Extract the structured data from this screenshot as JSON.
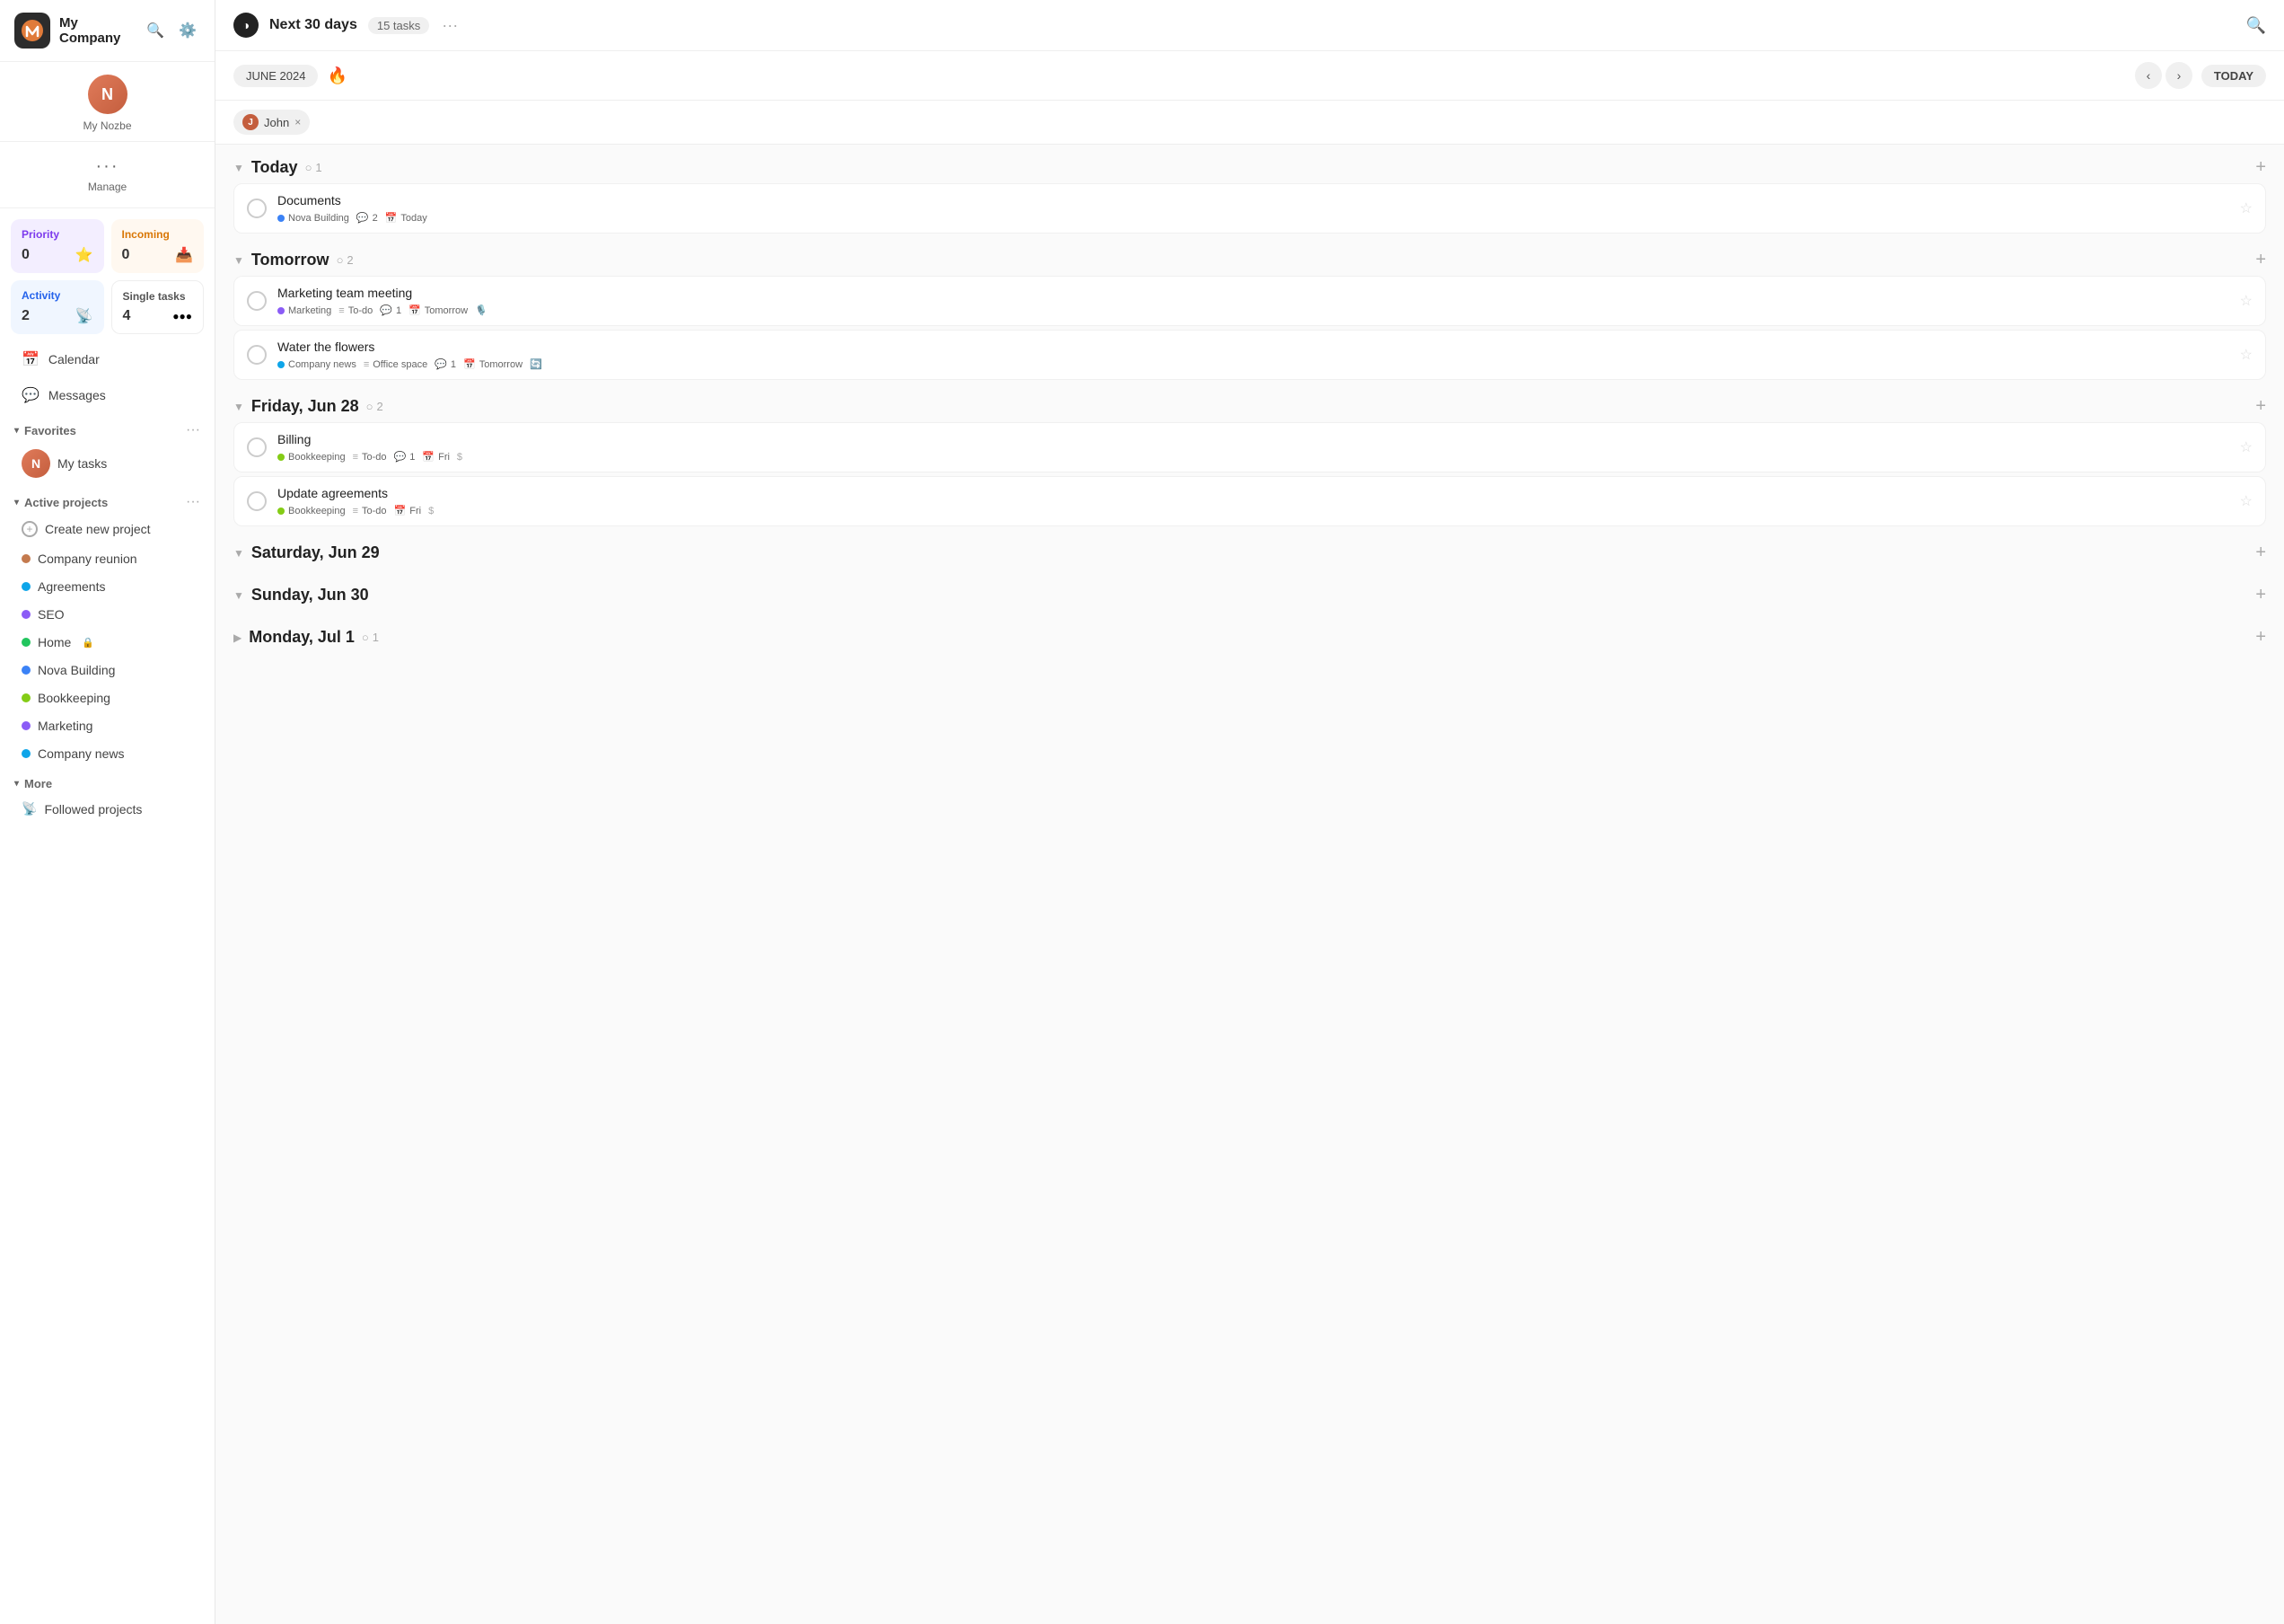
{
  "app": {
    "logo_text": "N",
    "company": "My Company",
    "user_initials": "N",
    "user_name": "My Nozbe"
  },
  "sidebar": {
    "search_label": "Search",
    "settings_label": "Settings",
    "manage_label": "Manage",
    "stats": {
      "priority": {
        "label": "Priority",
        "count": "0",
        "icon": "⭐"
      },
      "incoming": {
        "label": "Incoming",
        "count": "0",
        "icon": "📥"
      },
      "activity": {
        "label": "Activity",
        "count": "2",
        "icon": "📡"
      },
      "single_tasks": {
        "label": "Single tasks",
        "count": "4",
        "icon": "⬤⬤⬤"
      }
    },
    "calendar_label": "Calendar",
    "messages_label": "Messages",
    "favorites_label": "Favorites",
    "my_tasks_label": "My tasks",
    "active_projects_label": "Active projects",
    "projects": [
      {
        "name": "Create new project",
        "color": "none",
        "type": "add"
      },
      {
        "name": "Company reunion",
        "color": "#c47a4e"
      },
      {
        "name": "Agreements",
        "color": "#0ea5e9"
      },
      {
        "name": "SEO",
        "color": "#8b5cf6"
      },
      {
        "name": "Home",
        "color": "#22c55e",
        "locked": true
      },
      {
        "name": "Nova Building",
        "color": "#3b82f6"
      },
      {
        "name": "Bookkeeping",
        "color": "#84cc16"
      },
      {
        "name": "Marketing",
        "color": "#8b5cf6"
      },
      {
        "name": "Company news",
        "color": "#0ea5e9"
      }
    ],
    "more_label": "More",
    "followed_projects_label": "Followed projects"
  },
  "header": {
    "icon": "◑",
    "title": "Next 30 days",
    "task_count": "15 tasks",
    "more_icon": "···"
  },
  "toolbar": {
    "month": "JUNE 2024",
    "today": "TODAY"
  },
  "filter": {
    "user": "John",
    "close": "×"
  },
  "days": [
    {
      "title": "Today",
      "count": 1,
      "tasks": [
        {
          "title": "Documents",
          "project": "Nova Building",
          "project_color": "dot-blue",
          "meta": [
            {
              "icon": "💬",
              "value": "2"
            },
            {
              "icon": "📅",
              "value": "Today"
            }
          ]
        }
      ]
    },
    {
      "title": "Tomorrow",
      "count": 2,
      "tasks": [
        {
          "title": "Marketing team meeting",
          "project": "Marketing",
          "project_color": "dot-purple",
          "meta": [
            {
              "icon": "≡",
              "value": "To-do"
            },
            {
              "icon": "💬",
              "value": "1"
            },
            {
              "icon": "📅",
              "value": "Tomorrow"
            },
            {
              "icon": "🎙️",
              "value": ""
            }
          ]
        },
        {
          "title": "Water the flowers",
          "project": "Company news",
          "project_color": "dot-teal",
          "meta": [
            {
              "icon": "≡",
              "value": "Office space"
            },
            {
              "icon": "💬",
              "value": "1"
            },
            {
              "icon": "📅",
              "value": "Tomorrow"
            },
            {
              "icon": "🔄",
              "value": ""
            }
          ]
        }
      ]
    },
    {
      "title": "Friday, Jun 28",
      "count": 2,
      "tasks": [
        {
          "title": "Billing",
          "project": "Bookkeeping",
          "project_color": "dot-olive",
          "meta": [
            {
              "icon": "≡",
              "value": "To-do"
            },
            {
              "icon": "💬",
              "value": "1"
            },
            {
              "icon": "📅",
              "value": "Fri"
            },
            {
              "icon": "$",
              "value": ""
            }
          ]
        },
        {
          "title": "Update agreements",
          "project": "Bookkeeping",
          "project_color": "dot-olive",
          "meta": [
            {
              "icon": "≡",
              "value": "To-do"
            },
            {
              "icon": "📅",
              "value": "Fri"
            },
            {
              "icon": "$",
              "value": ""
            }
          ]
        }
      ]
    },
    {
      "title": "Saturday, Jun 29",
      "count": 0,
      "tasks": []
    },
    {
      "title": "Sunday, Jun 30",
      "count": 0,
      "tasks": []
    },
    {
      "title": "Monday, Jul 1",
      "count": 1,
      "tasks": [],
      "collapsed": true
    }
  ]
}
